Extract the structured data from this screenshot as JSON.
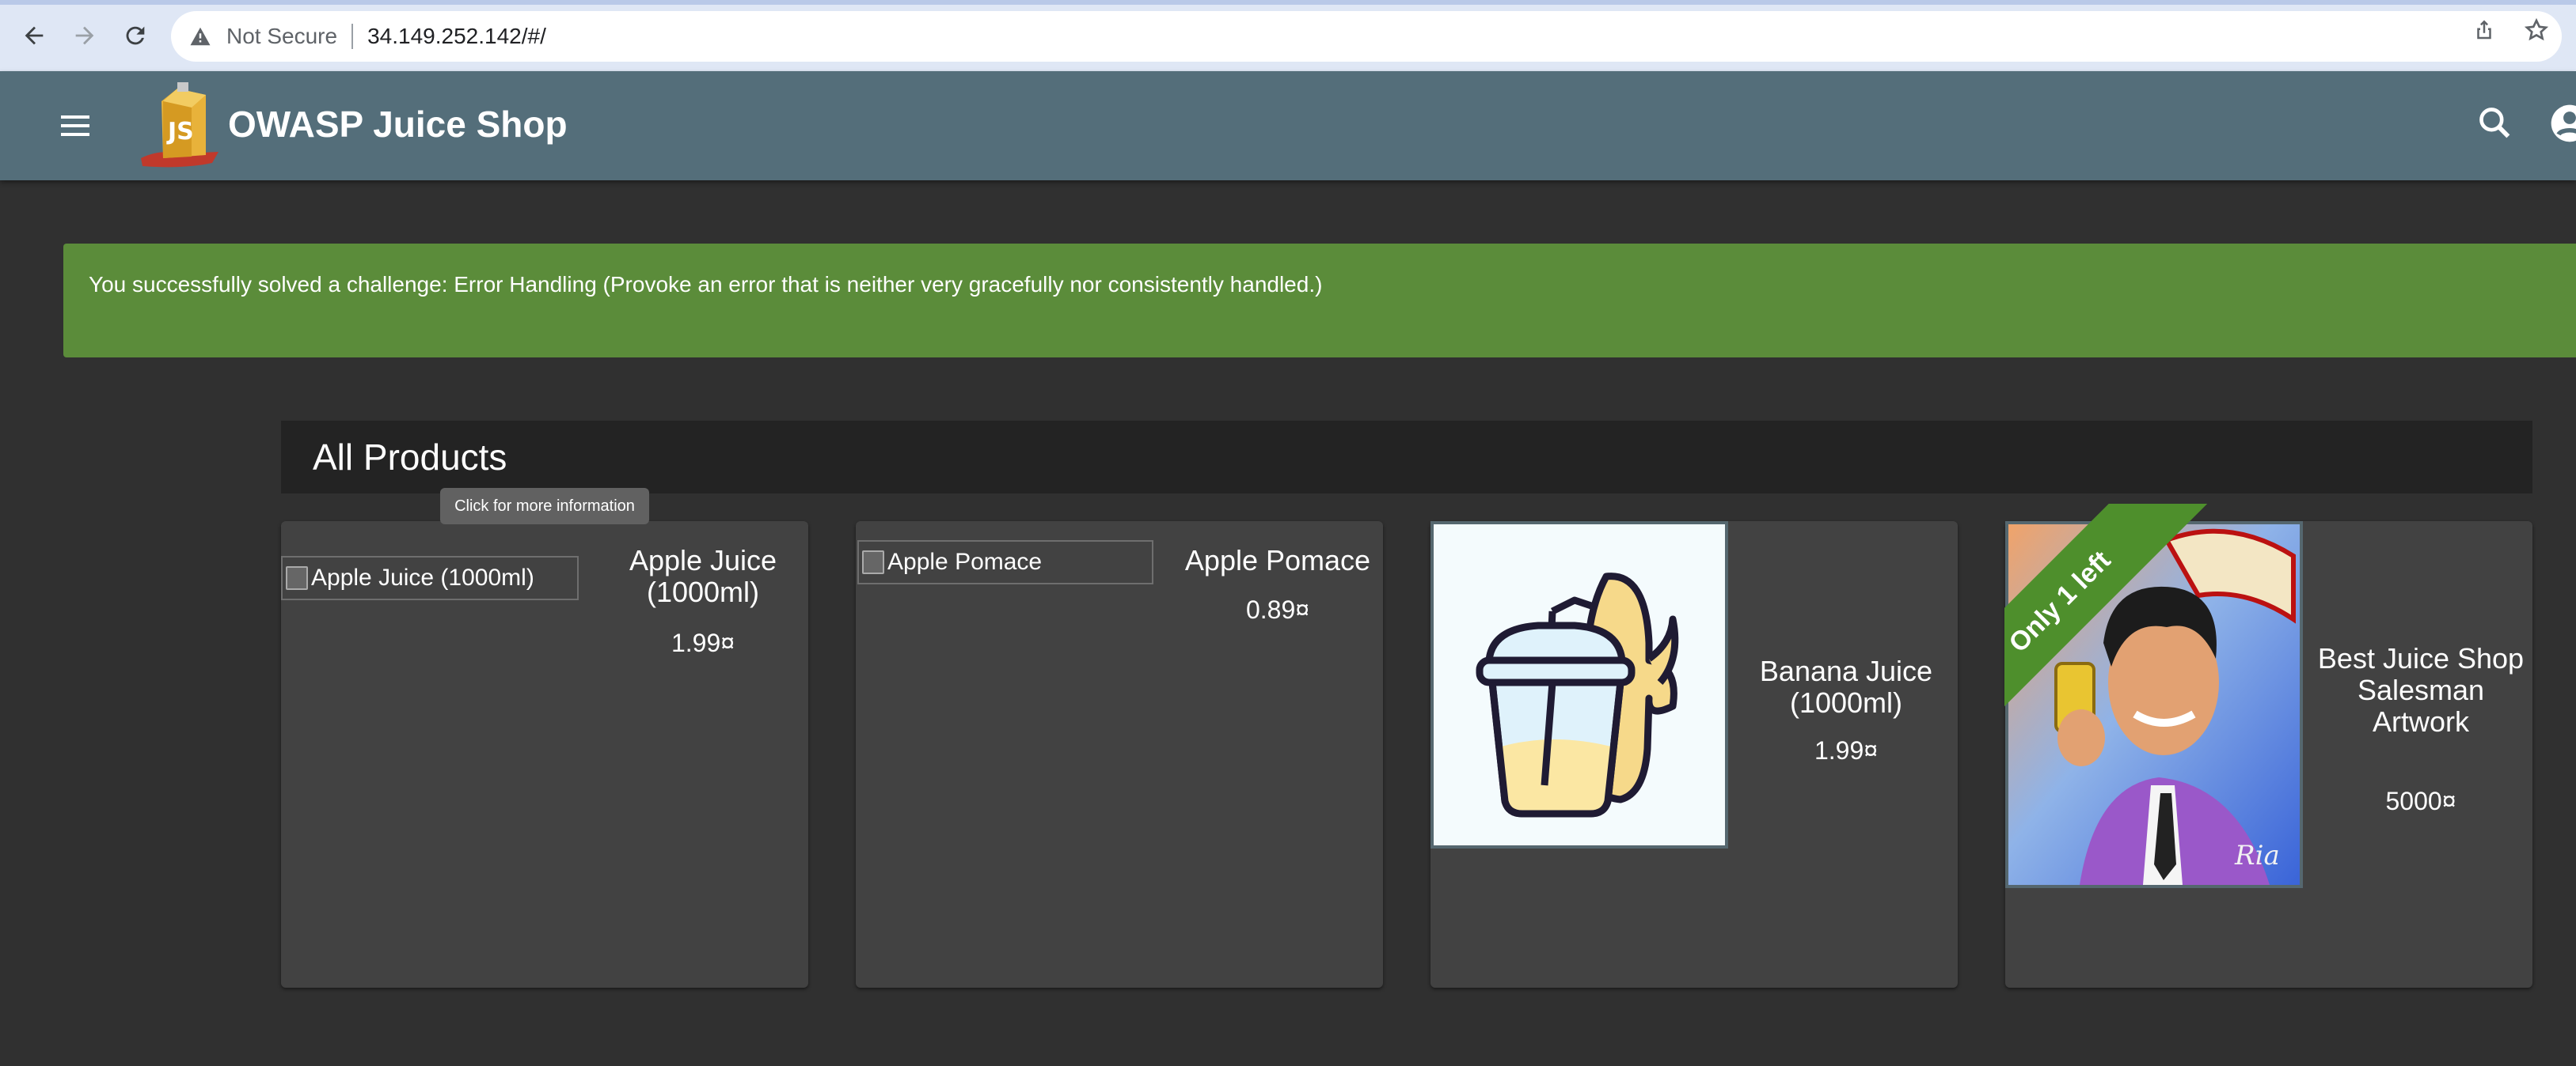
{
  "browser": {
    "security_label": "Not Secure",
    "url": "34.149.252.142/#/"
  },
  "app": {
    "title": "OWASP Juice Shop"
  },
  "snackbar": {
    "message": "You successfully solved a challenge: Error Handling (Provoke an error that is neither very gracefully nor consistently handled.)"
  },
  "products": {
    "heading": "All Products",
    "tooltip": "Click for more information",
    "items": [
      {
        "image_alt": "Apple Juice (1000ml)",
        "name": "Apple Juice (1000ml)",
        "price": "1.99¤"
      },
      {
        "image_alt": "Apple Pomace",
        "name": "Apple Pomace",
        "price": "0.89¤"
      },
      {
        "image_alt": "",
        "name": "Banana Juice (1000ml)",
        "price": "1.99¤"
      },
      {
        "image_alt": "",
        "name": "Best Juice Shop Salesman Artwork",
        "price": "5000¤",
        "ribbon": "Only 1 left"
      }
    ]
  },
  "colors": {
    "toolbar": "#546e7a",
    "background": "#303030",
    "card": "#424242",
    "snackbar": "#5b8c3a",
    "ribbon": "#4e8f2c"
  },
  "icons": [
    "back-icon",
    "forward-icon",
    "reload-icon",
    "warning-icon",
    "share-icon",
    "star-icon",
    "menu-icon",
    "search-icon",
    "account-icon"
  ]
}
